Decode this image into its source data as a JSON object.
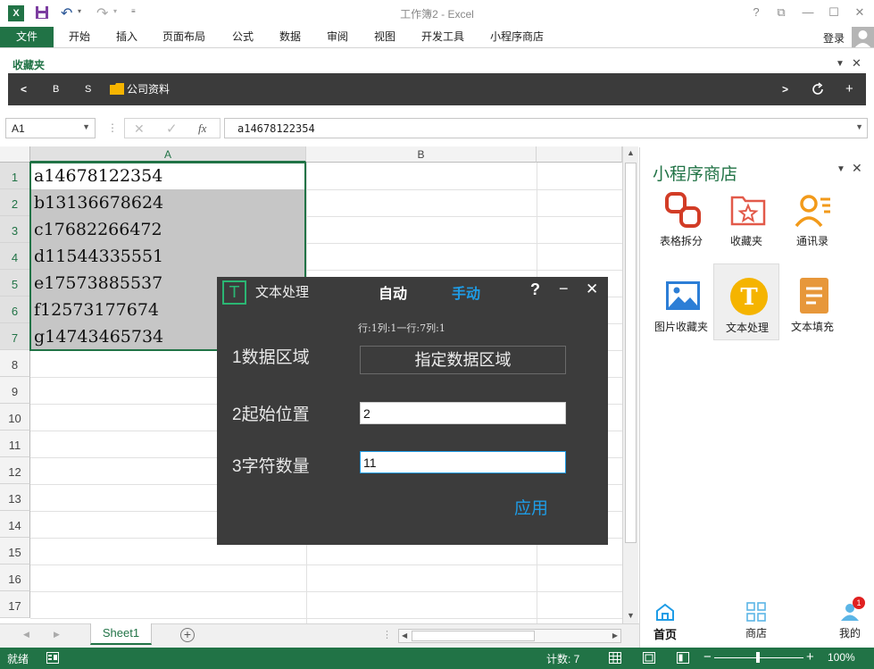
{
  "window": {
    "title": "工作簿2 - Excel",
    "help": "?",
    "restore_icon": "⧉",
    "minimize_icon": "—",
    "maximize_icon": "☐",
    "close_icon": "✕"
  },
  "ribbon": {
    "tabs": [
      "文件",
      "开始",
      "插入",
      "页面布局",
      "公式",
      "数据",
      "审阅",
      "视图",
      "开发工具",
      "小程序商店"
    ],
    "login": "登录"
  },
  "favorites": {
    "label": "收藏夹",
    "back": "<",
    "b": "B",
    "s": "S",
    "folder": "公司资料",
    "next": ">",
    "plus": "+"
  },
  "formula_bar": {
    "name_box": "A1",
    "fx": "fx",
    "value": "a14678122354"
  },
  "grid": {
    "columns": [
      "A",
      "B"
    ],
    "rows": [
      "1",
      "2",
      "3",
      "4",
      "5",
      "6",
      "7",
      "8",
      "9",
      "10",
      "11",
      "12",
      "13",
      "14",
      "15",
      "16",
      "17"
    ],
    "cells": [
      "a14678122354",
      "b13136678624",
      "c17682266472",
      "d11544335551",
      "e17573885537",
      "f12573177674",
      "g14743465734"
    ]
  },
  "sheets": {
    "active": "Sheet1",
    "add": "+"
  },
  "status": {
    "ready": "就绪",
    "count": "计数: 7",
    "zoom": "100%",
    "minus": "−",
    "plus": "+"
  },
  "panel": {
    "title": "小程序商店",
    "apps": [
      "表格拆分",
      "收藏夹",
      "通讯录",
      "图片收藏夹",
      "文本处理",
      "文本填充"
    ],
    "nav": {
      "home": "首页",
      "store": "商店",
      "mine": "我的",
      "badge": "1"
    }
  },
  "dialog": {
    "icon": "T",
    "title": "文本处理",
    "mode_auto": "自动",
    "mode_manual": "手动",
    "help": "?",
    "minimize": "−",
    "close": "✕",
    "info": "行:1列:1一行:7列:1",
    "label_range": "1数据区域",
    "button_range": "指定数据区域",
    "label_start": "2起始位置",
    "value_start": "2",
    "label_count": "3字符数量",
    "value_count": "11",
    "apply": "应用"
  },
  "colors": {
    "excel_green": "#217346",
    "dialog_bg": "#3c3c3c",
    "manual_accent": "#1e9ce6",
    "apply_accent": "#1e9ce6"
  }
}
